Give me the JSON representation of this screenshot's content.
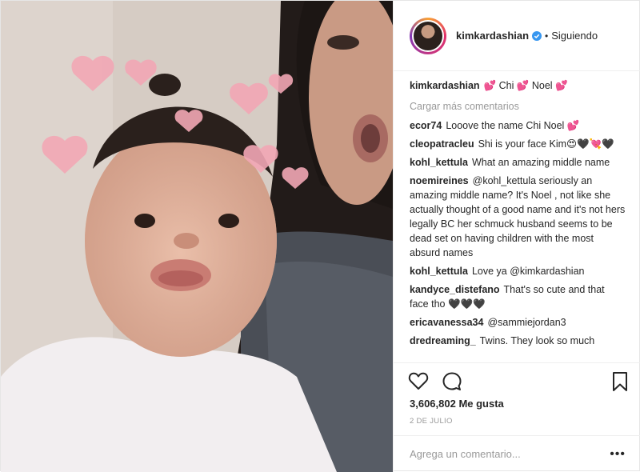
{
  "post": {
    "author": "kimkardashian",
    "verified": true,
    "separator": "•",
    "follow_status": "Siguiendo",
    "caption": "💕 Chi 💕 Noel 💕",
    "load_more": "Cargar más comentarios",
    "comments": [
      {
        "user": "ecor74",
        "text": "Looove the name Chi Noel 💕"
      },
      {
        "user": "cleopatracleu",
        "text": "Shi is your face Kim😍🖤💘🖤"
      },
      {
        "user": "kohl_kettula",
        "text": "What an amazing middle name"
      },
      {
        "user": "noemireines",
        "text": "@kohl_kettula seriously an amazing middle name? It's Noel , not like she actually thought of a good name and it's not hers legally BC her schmuck husband seems to be dead set on having children with the most absurd names"
      },
      {
        "user": "kohl_kettula",
        "text": "Love ya @kimkardashian"
      },
      {
        "user": "kandyce_distefano",
        "text": "That's so cute and that face tho 🖤🖤🖤"
      },
      {
        "user": "ericavanessa34",
        "text": "@sammiejordan3"
      },
      {
        "user": "dredreaming_",
        "text": "Twins. They look so much"
      }
    ],
    "likes": "3,606,802 Me gusta",
    "date": "2 DE JULIO",
    "add_comment_placeholder": "Agrega un comentario...",
    "more_options": "•••"
  },
  "icons": {
    "like": "heart-outline-icon",
    "comment": "speech-bubble-icon",
    "save": "bookmark-icon",
    "verified": "verified-badge-icon"
  },
  "colors": {
    "verified": "#3897f0",
    "text": "#262626",
    "muted": "#999999"
  }
}
